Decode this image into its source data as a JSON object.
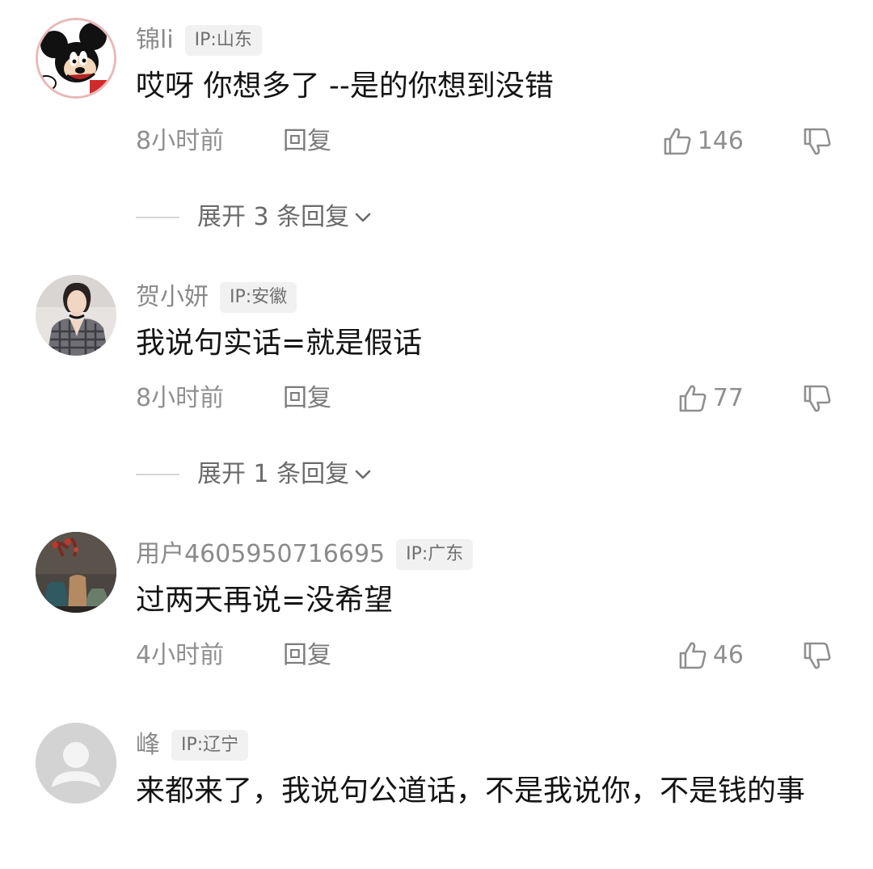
{
  "comments": [
    {
      "username": "锦li",
      "ip": "IP:山东",
      "text": "哎呀 你想多了 --是的你想到没错",
      "time": "8小时前",
      "reply_label": "回复",
      "likes": "146",
      "avatar_icon": "mickey-mouse-avatar",
      "expand_label": "展开 3 条回复"
    },
    {
      "username": "贺小妍",
      "ip": "IP:安徽",
      "text": "我说句实话=就是假话",
      "time": "8小时前",
      "reply_label": "回复",
      "likes": "77",
      "avatar_icon": "woman-portrait-avatar",
      "expand_label": "展开 1 条回复"
    },
    {
      "username": "用户4605950716695",
      "ip": "IP:广东",
      "text": "过两天再说=没希望",
      "time": "4小时前",
      "reply_label": "回复",
      "likes": "46",
      "avatar_icon": "vase-still-life-avatar"
    },
    {
      "username": "峰",
      "ip": "IP:辽宁",
      "text": "来都来了，我说句公道话，不是我说你，不是钱的事",
      "avatar_icon": "default-user-avatar"
    }
  ],
  "colors": {
    "text_primary": "#141414",
    "text_secondary": "#8f8f8f",
    "tag_background": "#f1f1f1",
    "default_avatar": "#d3d3d3"
  }
}
